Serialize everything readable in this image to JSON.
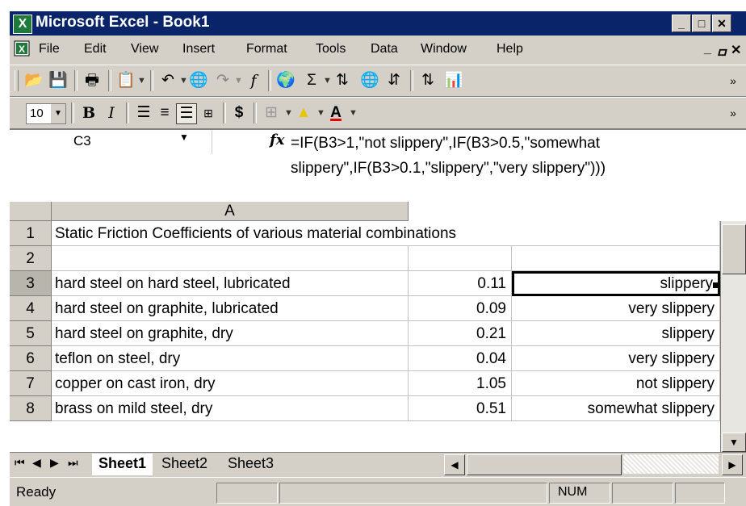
{
  "window": {
    "title": "Microsoft Excel - Book1"
  },
  "menu": [
    "File",
    "Edit",
    "View",
    "Insert",
    "Format",
    "Tools",
    "Data",
    "Window",
    "Help"
  ],
  "menu_underline": [
    "F",
    "E",
    "V",
    "I",
    "o",
    "T",
    "D",
    "W",
    "H"
  ],
  "toolbar": {
    "font_size": "10"
  },
  "formula_bar": {
    "cell_ref": "C3",
    "fx": "fx",
    "formula_line1": "=IF(B3>1,\"not slippery\",IF(B3>0.5,\"somewhat",
    "formula_line2": "slippery\",IF(B3>0.1,\"slippery\",\"very slippery\")))"
  },
  "sheet": {
    "column_a": "A",
    "rows": [
      {
        "num": "1",
        "a": "Static Friction Coefficients of various material combinations",
        "b": "",
        "c": ""
      },
      {
        "num": "2",
        "a": "",
        "b": "",
        "c": ""
      },
      {
        "num": "3",
        "a": "hard steel on hard steel, lubricated",
        "b": "0.11",
        "c": "slippery"
      },
      {
        "num": "4",
        "a": "hard steel on graphite, lubricated",
        "b": "0.09",
        "c": "very slippery"
      },
      {
        "num": "5",
        "a": "hard steel on graphite, dry",
        "b": "0.21",
        "c": "slippery"
      },
      {
        "num": "6",
        "a": "teflon on steel, dry",
        "b": "0.04",
        "c": "very slippery"
      },
      {
        "num": "7",
        "a": "copper on cast iron, dry",
        "b": "1.05",
        "c": "not slippery"
      },
      {
        "num": "8",
        "a": "brass on mild steel, dry",
        "b": "0.51",
        "c": "somewhat slippery"
      }
    ]
  },
  "tabs": {
    "items": [
      "Sheet1",
      "Sheet2",
      "Sheet3"
    ],
    "active": "Sheet1"
  },
  "status": {
    "text": "Ready",
    "num": "NUM"
  },
  "colors": {
    "title_bar": "#0a246a",
    "chrome": "#d4d0c8",
    "excel_icon": "#1d7a3a"
  }
}
